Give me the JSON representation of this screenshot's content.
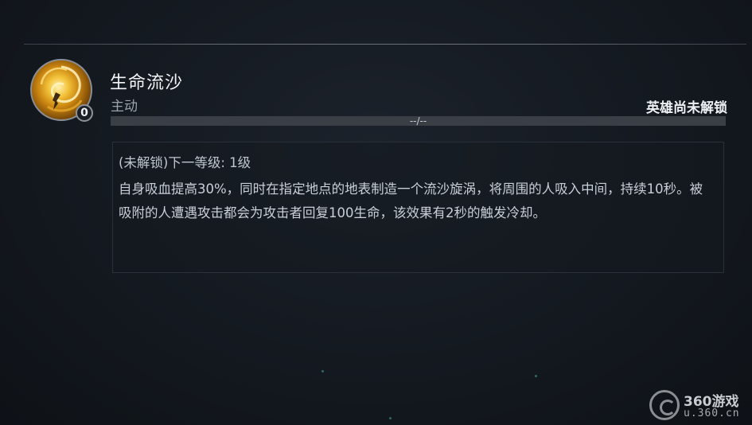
{
  "skill": {
    "name": "生命流沙",
    "type": "主动",
    "level_badge": "0",
    "icon": "sand-vortex-icon"
  },
  "hero_status": "英雄尚未解锁",
  "progress": {
    "text": "--/--",
    "fraction": 0
  },
  "description": {
    "level_line": "(未解锁)下一等级: 1级",
    "body": "自身吸血提高30%，同时在指定地点的地表制造一个流沙旋涡，将周围的人吸入中间，持续10秒。被吸附的人遭遇攻击都会为攻击者回复100生命，该效果有2秒的触发冷却。"
  },
  "watermark": {
    "title": "360游戏",
    "url": "u.360.cn"
  },
  "colors": {
    "icon_gold": "#f3c23a",
    "background": "#141920"
  }
}
